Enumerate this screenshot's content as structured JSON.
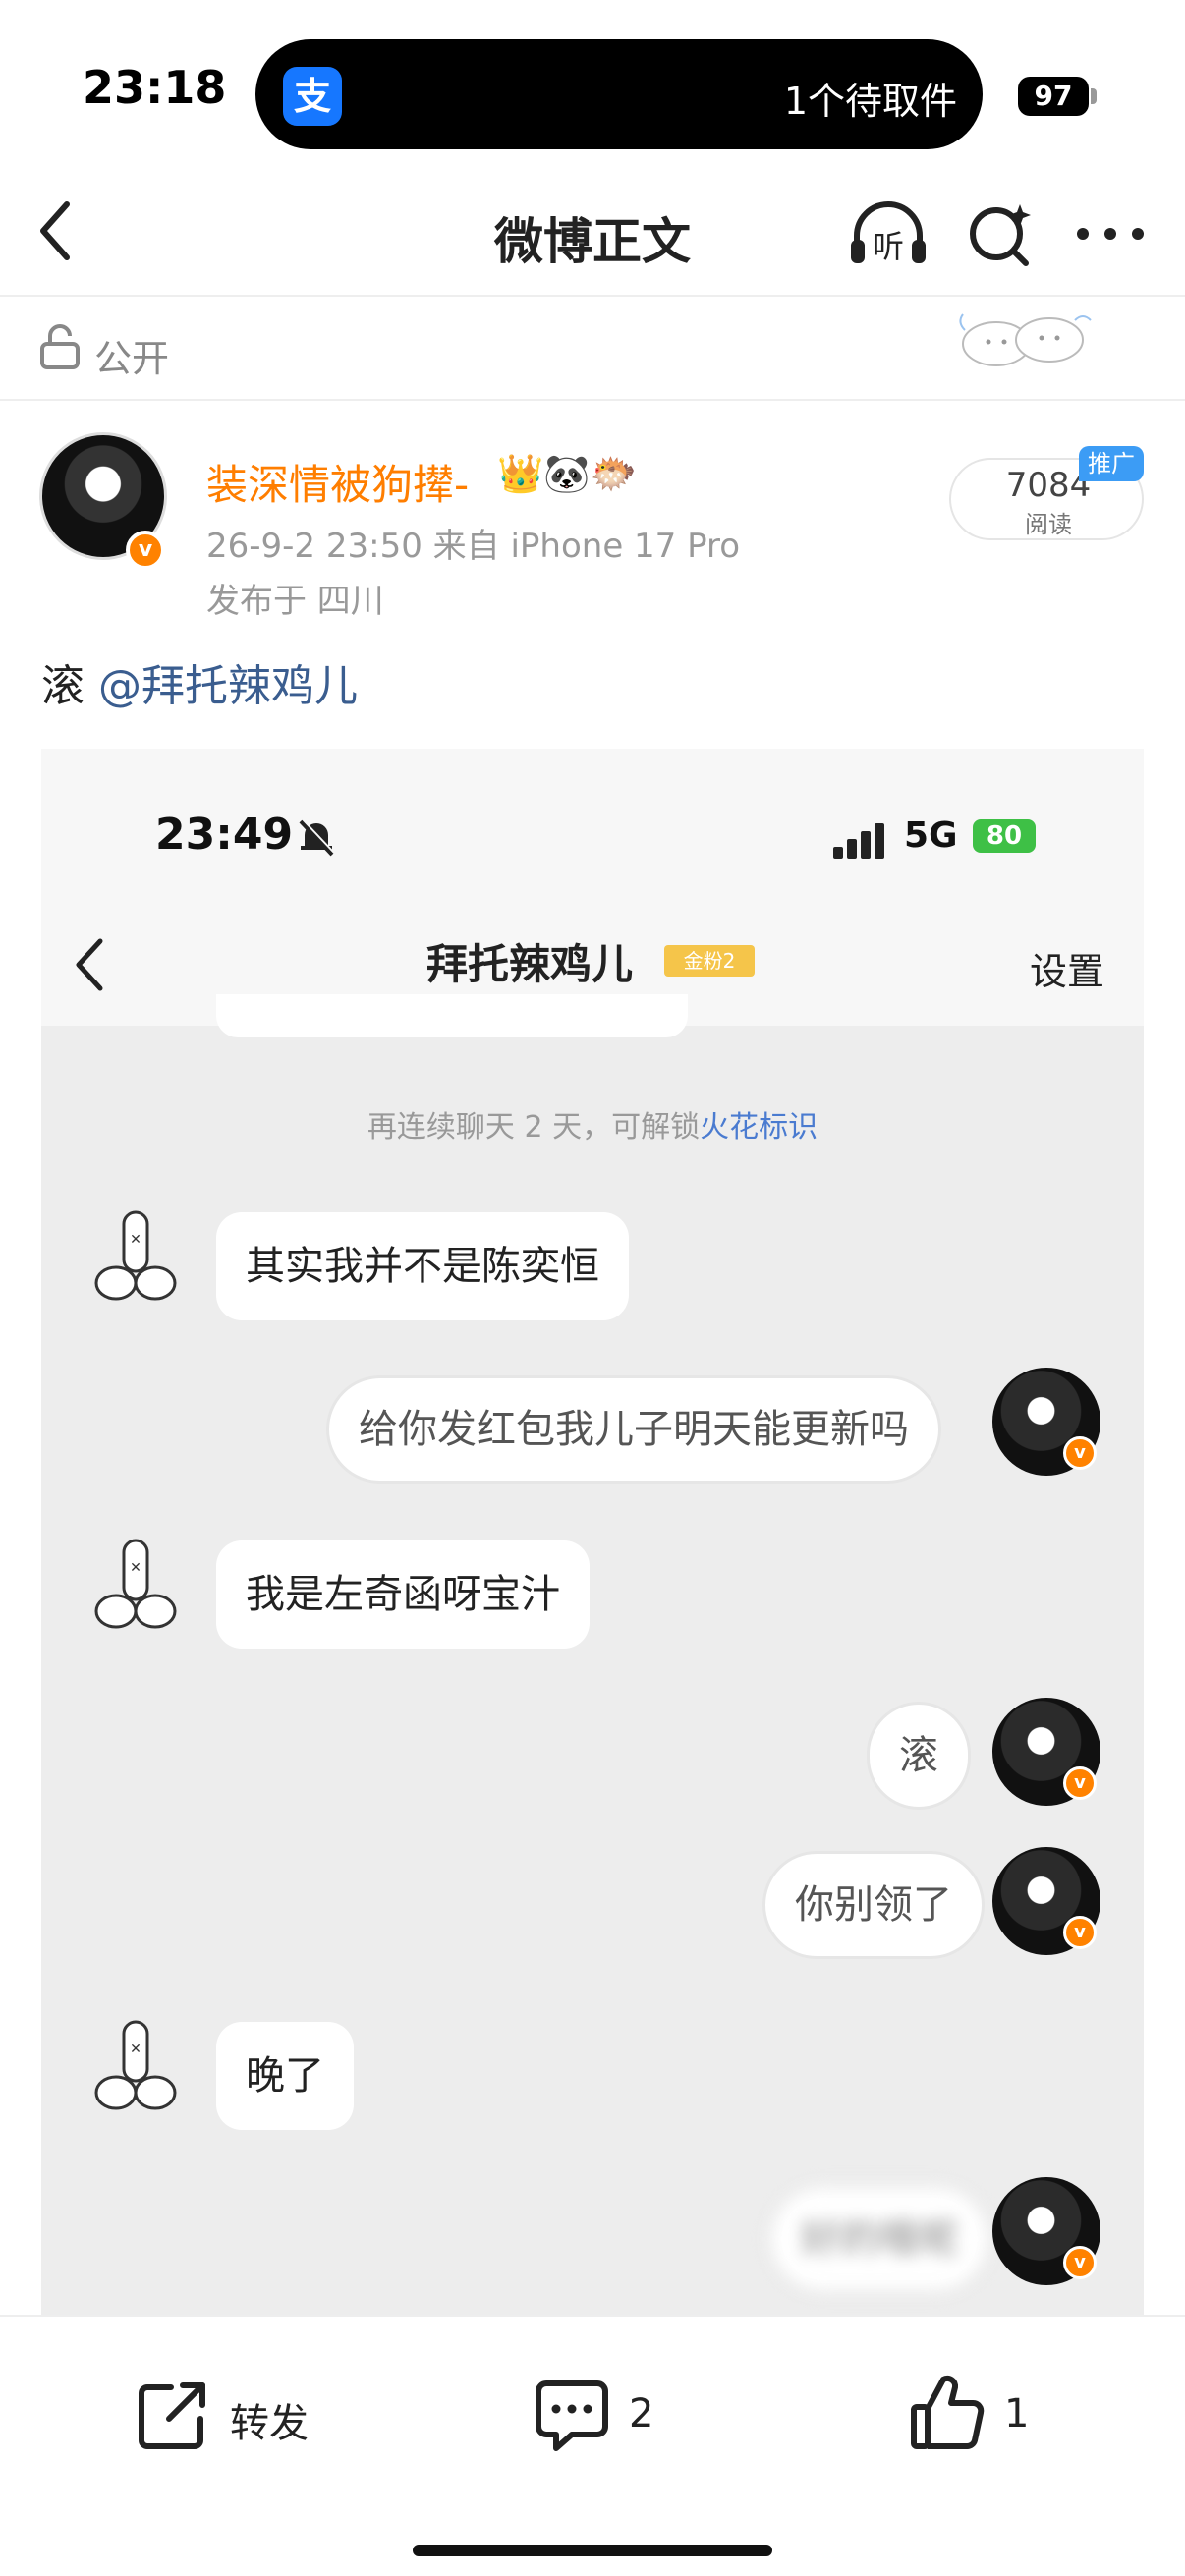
{
  "status_bar": {
    "time": "23:18",
    "island_app_icon": "支",
    "island_text": "1个待取件",
    "battery": "97"
  },
  "nav": {
    "title": "微博正文",
    "listen_label": "听"
  },
  "visibility": {
    "label": "公开"
  },
  "author": {
    "name": "装深情被狗撵-",
    "badges": "👑🐼🐡",
    "verified_mark": "v",
    "meta": "26-9-2 23:50  来自 iPhone 17 Pro",
    "location": "发布于 四川"
  },
  "reads": {
    "count": "7084",
    "label": "阅读",
    "promo": "推广"
  },
  "post": {
    "text": "滚 ",
    "mention": "@拜托辣鸡儿"
  },
  "screenshot": {
    "time": "23:49",
    "network": "5G",
    "battery": "80",
    "chat_title": "拜托辣鸡儿",
    "level_badge": "金粉2",
    "settings": "设置",
    "system_message": "再连续聊天 2 天，可解锁",
    "system_link": "火花标识",
    "messages": [
      {
        "side": "left",
        "text": "其实我并不是陈奕恒"
      },
      {
        "side": "right",
        "text": "给你发红包我儿子明天能更新吗"
      },
      {
        "side": "left",
        "text": "我是左奇函呀宝汁"
      },
      {
        "side": "right",
        "text": "滚"
      },
      {
        "side": "right",
        "text": "你别领了"
      },
      {
        "side": "left",
        "text": "晚了"
      },
      {
        "side": "right",
        "text": "好的哦呢"
      }
    ]
  },
  "actions": {
    "repost": "转发",
    "comments": "2",
    "likes": "1"
  },
  "colors": {
    "accent": "#ff8200",
    "link": "#3a5d8f",
    "author": "#ff7e00"
  }
}
